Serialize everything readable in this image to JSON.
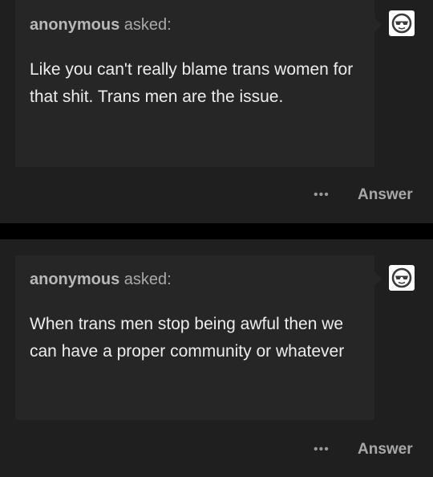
{
  "posts": [
    {
      "asker_name": "anonymous",
      "asked_label": " asked:",
      "question": "Like you can't really blame trans women for that shit. Trans men are the issue.",
      "avatar_icon": "sunglasses-face-icon",
      "more_label": "•••",
      "answer_label": "Answer"
    },
    {
      "asker_name": "anonymous",
      "asked_label": " asked:",
      "question": "When trans men stop being awful then we can have a proper community or whatever",
      "avatar_icon": "sunglasses-face-icon",
      "more_label": "•••",
      "answer_label": "Answer"
    }
  ],
  "colors": {
    "page_background": "#000000",
    "card_background": "#1f1f1f",
    "bubble_background": "#262626",
    "question_text": "#ededed",
    "muted_text": "#a8a8a8"
  }
}
